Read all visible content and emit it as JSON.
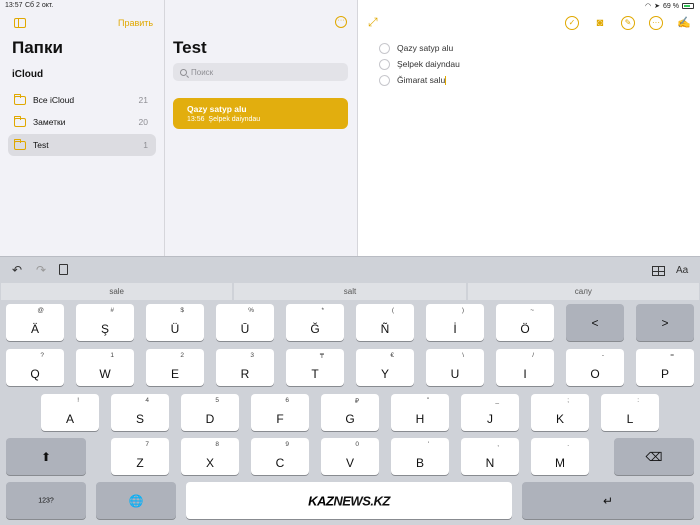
{
  "status": {
    "time": "13:57",
    "date": "Сб 2 окт.",
    "battery": "69 %"
  },
  "sidebar": {
    "edit_label": "Править",
    "title": "Папки",
    "section": "iCloud",
    "folders": [
      {
        "name": "Все iCloud",
        "count": "21"
      },
      {
        "name": "Заметки",
        "count": "20"
      },
      {
        "name": "Test",
        "count": "1"
      }
    ]
  },
  "notes_list": {
    "title": "Test",
    "search_placeholder": "Поиск",
    "note": {
      "title": "Qazy satyp alu",
      "time": "13:56",
      "preview": "Şelpek daiyndau"
    }
  },
  "editor": {
    "checklist": [
      "Qazy satyp alu",
      "Şelpek daiyndau",
      "Ğimarat salu"
    ]
  },
  "predictive": [
    "sale",
    "salt",
    "салу"
  ],
  "keyboard": {
    "row1": [
      {
        "main": "Ä",
        "sec": "@"
      },
      {
        "main": "Ş",
        "sec": "#"
      },
      {
        "main": "Ü",
        "sec": "$"
      },
      {
        "main": "Ū",
        "sec": "%"
      },
      {
        "main": "Ğ",
        "sec": "*"
      },
      {
        "main": "Ñ",
        "sec": "("
      },
      {
        "main": "İ",
        "sec": ")"
      },
      {
        "main": "Ö",
        "sec": "~"
      }
    ],
    "row1_dark": [
      "<",
      ">"
    ],
    "row2": [
      {
        "main": "Q",
        "sec": "?"
      },
      {
        "main": "W",
        "sec": "1"
      },
      {
        "main": "E",
        "sec": "2"
      },
      {
        "main": "R",
        "sec": "3"
      },
      {
        "main": "T",
        "sec": "₸"
      },
      {
        "main": "Y",
        "sec": "€"
      },
      {
        "main": "U",
        "sec": "\\"
      },
      {
        "main": "I",
        "sec": "/"
      },
      {
        "main": "O",
        "sec": "-"
      },
      {
        "main": "P",
        "sec": "="
      }
    ],
    "row3": [
      {
        "main": "A",
        "sec": "!"
      },
      {
        "main": "S",
        "sec": "4"
      },
      {
        "main": "D",
        "sec": "5"
      },
      {
        "main": "F",
        "sec": "6"
      },
      {
        "main": "G",
        "sec": "₽"
      },
      {
        "main": "H",
        "sec": "\""
      },
      {
        "main": "J",
        "sec": "_"
      },
      {
        "main": "K",
        "sec": ";"
      },
      {
        "main": "L",
        "sec": ":"
      }
    ],
    "row4": [
      {
        "main": "Z",
        "sec": "7"
      },
      {
        "main": "X",
        "sec": "8"
      },
      {
        "main": "C",
        "sec": "9"
      },
      {
        "main": "V",
        "sec": "0"
      },
      {
        "main": "B",
        "sec": "'"
      },
      {
        "main": "N",
        "sec": ","
      },
      {
        "main": "M",
        "sec": "."
      }
    ],
    "numbers_label": "123?",
    "space_logo_a": "KAZ",
    "space_logo_b": "NEWS.KZ"
  }
}
